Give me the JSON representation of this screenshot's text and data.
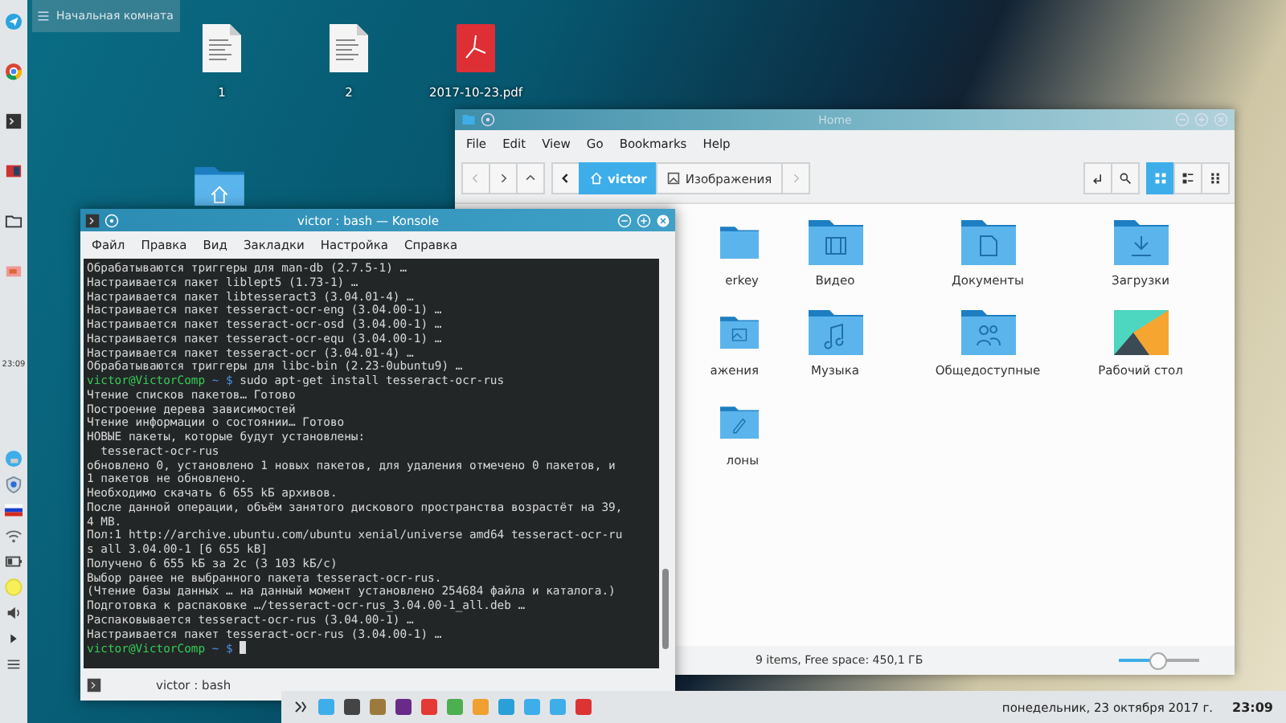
{
  "left_panel": {
    "clock": "23:09"
  },
  "desktop": {
    "widget_title": "Начальная комната",
    "icons": [
      {
        "label": "1",
        "kind": "document"
      },
      {
        "label": "2",
        "kind": "document"
      },
      {
        "label": "2017-10-23.pdf",
        "kind": "pdf"
      }
    ]
  },
  "file_manager": {
    "title": "Home",
    "menu": [
      "File",
      "Edit",
      "View",
      "Go",
      "Bookmarks",
      "Help"
    ],
    "breadcrumb": [
      {
        "label": "victor",
        "selected": true
      },
      {
        "label": "Изображения",
        "selected": false
      }
    ],
    "view_modes": [
      {
        "kind": "icons",
        "selected": true
      },
      {
        "kind": "compact",
        "selected": false
      },
      {
        "kind": "details",
        "selected": false
      }
    ],
    "items": [
      {
        "label": "erkey",
        "kind": "folder"
      },
      {
        "label": "Видео",
        "kind": "video"
      },
      {
        "label": "Документы",
        "kind": "documents"
      },
      {
        "label": "Загрузки",
        "kind": "downloads"
      },
      {
        "label": "ажения",
        "kind": "pictures"
      },
      {
        "label": "Музыка",
        "kind": "music"
      },
      {
        "label": "Общедоступные",
        "kind": "public"
      },
      {
        "label": "Рабочий стол",
        "kind": "desktop"
      },
      {
        "label": "лоны",
        "kind": "templates"
      }
    ],
    "status": "9 items, Free space: 450,1 ГБ",
    "zoom": {
      "level": 0.5
    }
  },
  "konsole": {
    "title": "victor : bash — Konsole",
    "menu": [
      "Файл",
      "Правка",
      "Вид",
      "Закладки",
      "Настройка",
      "Справка"
    ],
    "lines": [
      {
        "kind": "output",
        "text": "Обрабатываются триггеры для man-db (2.7.5-1) …"
      },
      {
        "kind": "output",
        "text": "Настраивается пакет liblept5 (1.73-1) …"
      },
      {
        "kind": "output",
        "text": "Настраивается пакет libtesseract3 (3.04.01-4) …"
      },
      {
        "kind": "output",
        "text": "Настраивается пакет tesseract-ocr-eng (3.04.00-1) …"
      },
      {
        "kind": "output",
        "text": "Настраивается пакет tesseract-ocr-osd (3.04.00-1) …"
      },
      {
        "kind": "output",
        "text": "Настраивается пакет tesseract-ocr-equ (3.04.00-1) …"
      },
      {
        "kind": "output",
        "text": "Настраивается пакет tesseract-ocr (3.04.01-4) …"
      },
      {
        "kind": "output",
        "text": "Обрабатываются триггеры для libc-bin (2.23-0ubuntu9) …"
      },
      {
        "kind": "prompt",
        "user": "victor@VictorComp",
        "dir": "~ $",
        "command": "sudo apt-get install tesseract-ocr-rus"
      },
      {
        "kind": "output",
        "text": "Чтение списков пакетов… Готово"
      },
      {
        "kind": "output",
        "text": "Построение дерева зависимостей"
      },
      {
        "kind": "output",
        "text": "Чтение информации о состоянии… Готово"
      },
      {
        "kind": "output",
        "text": "НОВЫЕ пакеты, которые будут установлены:"
      },
      {
        "kind": "output",
        "text": "  tesseract-ocr-rus"
      },
      {
        "kind": "output",
        "text": "обновлено 0, установлено 1 новых пакетов, для удаления отмечено 0 пакетов, и"
      },
      {
        "kind": "output",
        "text": "1 пакетов не обновлено."
      },
      {
        "kind": "output",
        "text": "Необходимо скачать 6 655 kБ архивов."
      },
      {
        "kind": "output",
        "text": "После данной операции, объём занятого дискового пространства возрастёт на 39,"
      },
      {
        "kind": "output",
        "text": "4 MB."
      },
      {
        "kind": "output",
        "text": "Пол:1 http://archive.ubuntu.com/ubuntu xenial/universe amd64 tesseract-ocr-ru"
      },
      {
        "kind": "output",
        "text": "s all 3.04.00-1 [6 655 kB]"
      },
      {
        "kind": "output",
        "text": "Получено 6 655 kБ за 2c (3 103 kБ/c)"
      },
      {
        "kind": "output",
        "text": "Выбор ранее не выбранного пакета tesseract-ocr-rus."
      },
      {
        "kind": "output",
        "text": "(Чтение базы данных … на данный момент установлено 254684 файла и каталога.)"
      },
      {
        "kind": "output",
        "text": "Подготовка к распаковке …/tesseract-ocr-rus_3.04.00-1_all.deb …"
      },
      {
        "kind": "output",
        "text": "Распаковывается tesseract-ocr-rus (3.04.00-1) …"
      },
      {
        "kind": "output",
        "text": "Настраивается пакет tesseract-ocr-rus (3.04.00-1) …"
      },
      {
        "kind": "prompt",
        "user": "victor@VictorComp",
        "dir": "~ $",
        "cursor": true
      }
    ],
    "tab": "victor : bash"
  },
  "taskbar": {
    "date": "понедельник, 23 октября 2017 г.",
    "time": "23:09"
  }
}
